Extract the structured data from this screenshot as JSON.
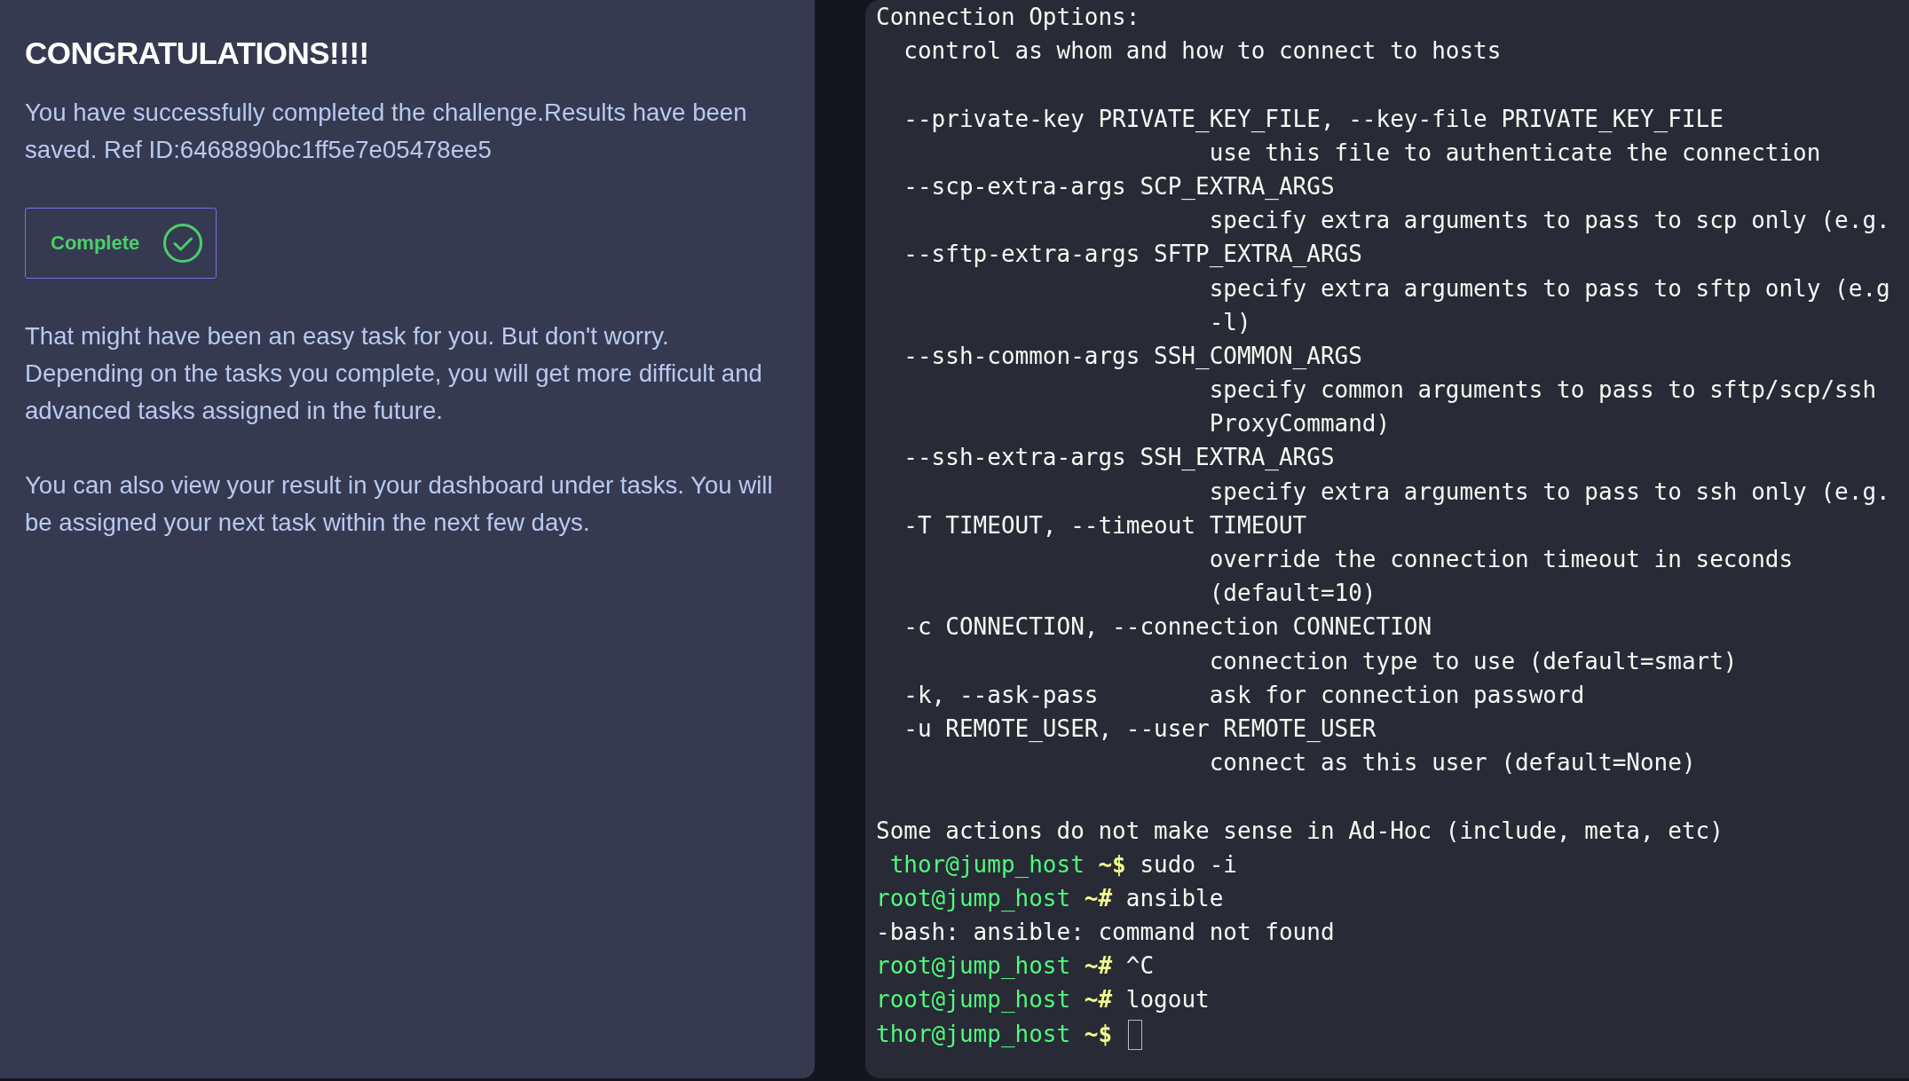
{
  "result_panel": {
    "title": "CONGRATULATIONS!!!!",
    "message": "You have successfully completed the challenge.Results have been saved. Ref ID:6468890bc1ff5e7e05478ee5",
    "status": {
      "label": "Complete",
      "complete": true
    },
    "paragraphs": [
      "That might have been an easy task for you. But don't worry. Depending on the tasks you complete, you will get more difficult and advanced tasks assigned in the future.",
      "You can also view your result in your dashboard under tasks. You will be assigned your next task within the next few days."
    ]
  },
  "terminal": {
    "lines": [
      {
        "kind": "text",
        "text": "Connection Options:"
      },
      {
        "kind": "text",
        "text": "  control as whom and how to connect to hosts"
      },
      {
        "kind": "blank"
      },
      {
        "kind": "text",
        "text": "  --private-key PRIVATE_KEY_FILE, --key-file PRIVATE_KEY_FILE"
      },
      {
        "kind": "text",
        "text": "                        use this file to authenticate the connection"
      },
      {
        "kind": "text",
        "text": "  --scp-extra-args SCP_EXTRA_ARGS"
      },
      {
        "kind": "text",
        "text": "                        specify extra arguments to pass to scp only (e.g."
      },
      {
        "kind": "text",
        "text": "  --sftp-extra-args SFTP_EXTRA_ARGS"
      },
      {
        "kind": "text",
        "text": "                        specify extra arguments to pass to sftp only (e.g"
      },
      {
        "kind": "text",
        "text": "                        -l)"
      },
      {
        "kind": "text",
        "text": "  --ssh-common-args SSH_COMMON_ARGS"
      },
      {
        "kind": "text",
        "text": "                        specify common arguments to pass to sftp/scp/ssh"
      },
      {
        "kind": "text",
        "text": "                        ProxyCommand)"
      },
      {
        "kind": "text",
        "text": "  --ssh-extra-args SSH_EXTRA_ARGS"
      },
      {
        "kind": "text",
        "text": "                        specify extra arguments to pass to ssh only (e.g."
      },
      {
        "kind": "text",
        "text": "  -T TIMEOUT, --timeout TIMEOUT"
      },
      {
        "kind": "text",
        "text": "                        override the connection timeout in seconds"
      },
      {
        "kind": "text",
        "text": "                        (default=10)"
      },
      {
        "kind": "text",
        "text": "  -c CONNECTION, --connection CONNECTION"
      },
      {
        "kind": "text",
        "text": "                        connection type to use (default=smart)"
      },
      {
        "kind": "text",
        "text": "  -k, --ask-pass        ask for connection password"
      },
      {
        "kind": "text",
        "text": "  -u REMOTE_USER, --user REMOTE_USER"
      },
      {
        "kind": "text",
        "text": "                        connect as this user (default=None)"
      },
      {
        "kind": "blank"
      },
      {
        "kind": "text",
        "text": "Some actions do not make sense in Ad-Hoc (include, meta, etc)"
      },
      {
        "kind": "prompt",
        "user_host": " thor@jump_host",
        "symbol": "~$",
        "command": "sudo -i",
        "cursor": false
      },
      {
        "kind": "prompt",
        "user_host": "root@jump_host",
        "symbol": "~#",
        "command": "ansible",
        "cursor": false
      },
      {
        "kind": "text",
        "text": "-bash: ansible: command not found"
      },
      {
        "kind": "prompt",
        "user_host": "root@jump_host",
        "symbol": "~#",
        "command": "^C",
        "cursor": false
      },
      {
        "kind": "prompt",
        "user_host": "root@jump_host",
        "symbol": "~#",
        "command": "logout",
        "cursor": false
      },
      {
        "kind": "prompt",
        "user_host": "thor@jump_host",
        "symbol": "~$",
        "cursor": true
      }
    ]
  }
}
